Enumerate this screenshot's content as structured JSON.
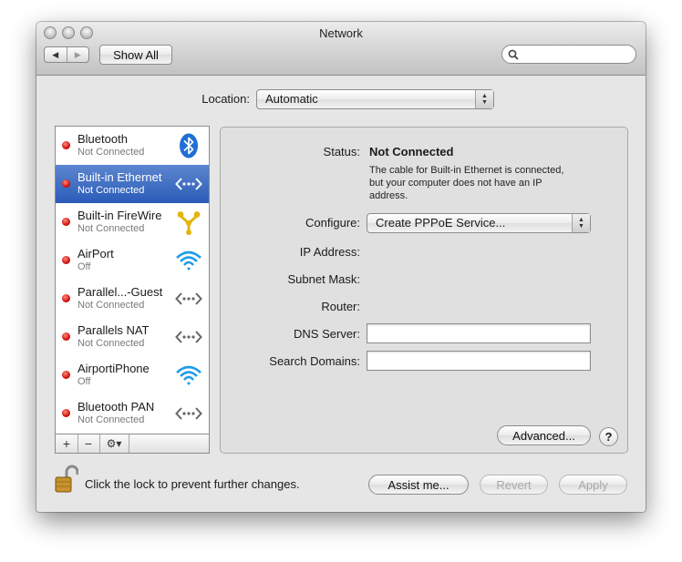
{
  "window": {
    "title": "Network"
  },
  "toolbar": {
    "back_label": "◀",
    "forward_label": "▶",
    "show_all_label": "Show All",
    "search_value": ""
  },
  "location": {
    "label": "Location:",
    "value": "Automatic"
  },
  "services": [
    {
      "name": "Bluetooth",
      "status": "Not Connected",
      "icon": "bluetooth-icon",
      "selected": false
    },
    {
      "name": "Built-in Ethernet",
      "status": "Not Connected",
      "icon": "ethernet-icon",
      "selected": true
    },
    {
      "name": "Built-in FireWire",
      "status": "Not Connected",
      "icon": "firewire-icon",
      "selected": false
    },
    {
      "name": "AirPort",
      "status": "Off",
      "icon": "wifi-icon",
      "selected": false
    },
    {
      "name": "Parallel...-Guest",
      "status": "Not Connected",
      "icon": "ethernet-icon",
      "selected": false
    },
    {
      "name": "Parallels NAT",
      "status": "Not Connected",
      "icon": "ethernet-icon",
      "selected": false
    },
    {
      "name": "AirportiPhone",
      "status": "Off",
      "icon": "wifi-icon",
      "selected": false
    },
    {
      "name": "Bluetooth PAN",
      "status": "Not Connected",
      "icon": "ethernet-icon",
      "selected": false
    }
  ],
  "list_actions": {
    "add_label": "+",
    "remove_label": "−",
    "gear_label": "⚙▾"
  },
  "detail": {
    "status_label": "Status:",
    "status_value": "Not Connected",
    "status_desc_1": "The cable for Built-in Ethernet is connected,",
    "status_desc_2": "but your computer does not have an IP",
    "status_desc_3": "address.",
    "configure_label": "Configure:",
    "configure_value": "Create PPPoE Service...",
    "ip_label": "IP Address:",
    "subnet_label": "Subnet Mask:",
    "router_label": "Router:",
    "dns_label": "DNS Server:",
    "dns_value": "",
    "search_domains_label": "Search Domains:",
    "search_domains_value": "",
    "advanced_label": "Advanced...",
    "help_label": "?"
  },
  "footer": {
    "lock_text": "Click the lock to prevent further changes.",
    "assist_label": "Assist me...",
    "revert_label": "Revert",
    "apply_label": "Apply"
  },
  "colors": {
    "selection": "#2a5bb8",
    "status_dot": "#d3110b",
    "wifi": "#1e9be9",
    "bluetooth": "#1f6fd6",
    "firewire": "#e2b50f"
  }
}
